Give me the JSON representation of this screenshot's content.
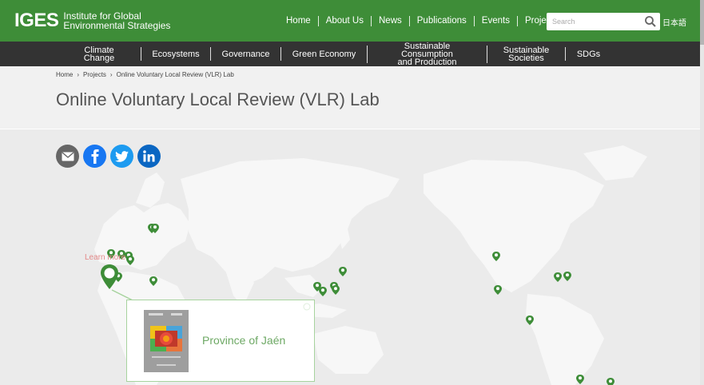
{
  "header": {
    "logo_mark": "IGES",
    "logo_line1": "Institute for Global",
    "logo_line2": "Environmental Strategies",
    "nav": [
      "Home",
      "About Us",
      "News",
      "Publications",
      "Events",
      "Projects"
    ],
    "search_placeholder": "Search",
    "language": "日本語"
  },
  "categories": [
    {
      "line1": "Climate Change",
      "line2": ""
    },
    {
      "line1": "Ecosystems",
      "line2": ""
    },
    {
      "line1": "Governance",
      "line2": ""
    },
    {
      "line1": "Green Economy",
      "line2": ""
    },
    {
      "line1": "Sustainable Consumption",
      "line2": "and Production"
    },
    {
      "line1": "Sustainable",
      "line2": "Societies"
    },
    {
      "line1": "SDGs",
      "line2": ""
    }
  ],
  "breadcrumb": [
    "Home",
    "›",
    "Projects",
    "›",
    "Online Voluntary Local Review (VLR) Lab"
  ],
  "page_title": "Online Voluntary Local Review (VLR) Lab",
  "share": [
    {
      "name": "email",
      "color": "#666666"
    },
    {
      "name": "facebook",
      "color": "#1877f2"
    },
    {
      "name": "twitter",
      "color": "#1d9bf0"
    },
    {
      "name": "linkedin",
      "color": "#0a66c2"
    }
  ],
  "map": {
    "learn_more": "Learn more",
    "popup_title": "Province of Jaén",
    "pin_color": "#3e8d38"
  },
  "colors": {
    "brand_green": "#3e8d38",
    "nav_dark": "#333333"
  }
}
